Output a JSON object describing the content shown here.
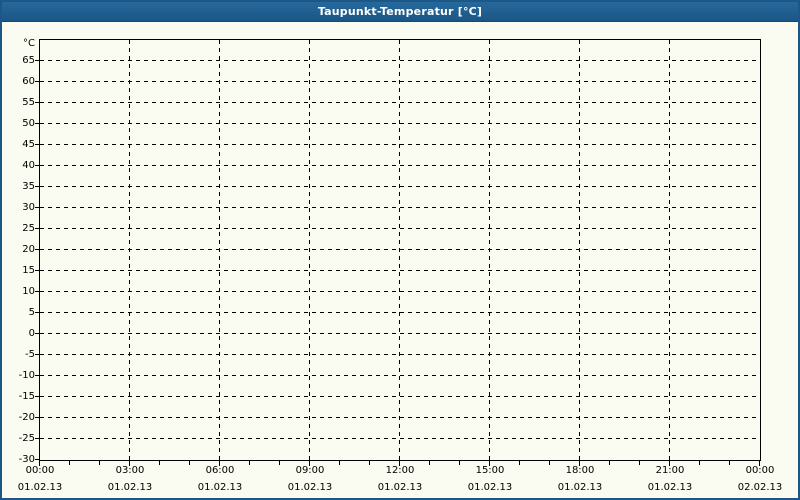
{
  "window": {
    "title": "Taupunkt-Temperatur [°C]"
  },
  "colors": {
    "titlebar_top": "#27699c",
    "titlebar_bottom": "#1b5685",
    "window_border": "#1c5887",
    "background": "#fafcf2",
    "grid": "#000000",
    "text": "#000000",
    "title_text": "#ffffff"
  },
  "chart_data": {
    "type": "line",
    "title": "Taupunkt-Temperatur [°C]",
    "xlabel": "",
    "ylabel": "°C",
    "ylim": [
      -30,
      70
    ],
    "yticks": [
      -30,
      -25,
      -20,
      -15,
      -10,
      -5,
      0,
      5,
      10,
      15,
      20,
      25,
      30,
      35,
      40,
      45,
      50,
      55,
      60,
      65
    ],
    "xlim_hours": [
      0,
      24
    ],
    "x_major_tick_hours": 3,
    "x_minor_tick_hours": 1,
    "xticks": [
      {
        "hour": 0,
        "time": "00:00",
        "date": "01.02.13"
      },
      {
        "hour": 3,
        "time": "03:00",
        "date": "01.02.13"
      },
      {
        "hour": 6,
        "time": "06:00",
        "date": "01.02.13"
      },
      {
        "hour": 9,
        "time": "09:00",
        "date": "01.02.13"
      },
      {
        "hour": 12,
        "time": "12:00",
        "date": "01.02.13"
      },
      {
        "hour": 15,
        "time": "15:00",
        "date": "01.02.13"
      },
      {
        "hour": 18,
        "time": "18:00",
        "date": "01.02.13"
      },
      {
        "hour": 21,
        "time": "21:00",
        "date": "01.02.13"
      },
      {
        "hour": 24,
        "time": "00:00",
        "date": "02.02.13"
      }
    ],
    "grid": true,
    "grid_style": "dashed",
    "legend": null,
    "series": []
  }
}
